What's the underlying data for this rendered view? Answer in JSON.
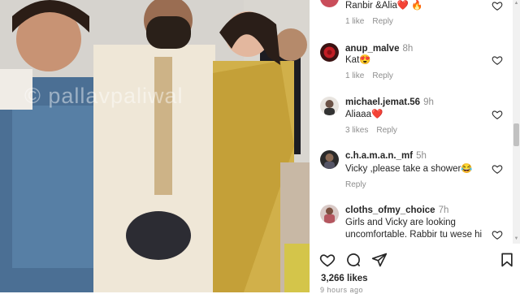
{
  "photo": {
    "watermark": "© pallavpaliwal"
  },
  "comments": [
    {
      "username": "",
      "time": "",
      "text": "Ranbir &Alia❤️ 🔥",
      "likes": "1 like",
      "reply": "Reply"
    },
    {
      "username": "anup_malve",
      "time": "8h",
      "text": "Kat😍",
      "likes": "1 like",
      "reply": "Reply"
    },
    {
      "username": "michael.jemat.56",
      "time": "9h",
      "text": "Aliaaa❤️",
      "likes": "3 likes",
      "reply": "Reply"
    },
    {
      "username": "c.h.a.m.a.n._mf",
      "time": "5h",
      "text": "Vicky ,please take a shower😂",
      "likes": "",
      "reply": "Reply"
    },
    {
      "username": "cloths_ofmy_choice",
      "time": "7h",
      "text": "Girls and Vicky are looking uncomfortable. Rabbir tu wese hi",
      "likes": "",
      "reply": ""
    }
  ],
  "post": {
    "likes": "3,266 likes",
    "time_ago": "9 hours ago"
  },
  "icons": {
    "like": "heart-outline-icon",
    "comment": "comment-bubble-icon",
    "share": "paper-plane-icon",
    "save": "bookmark-icon"
  },
  "colors": {
    "text": "#262626",
    "muted": "#8e8e8e",
    "heart_red": "#e0245e"
  }
}
